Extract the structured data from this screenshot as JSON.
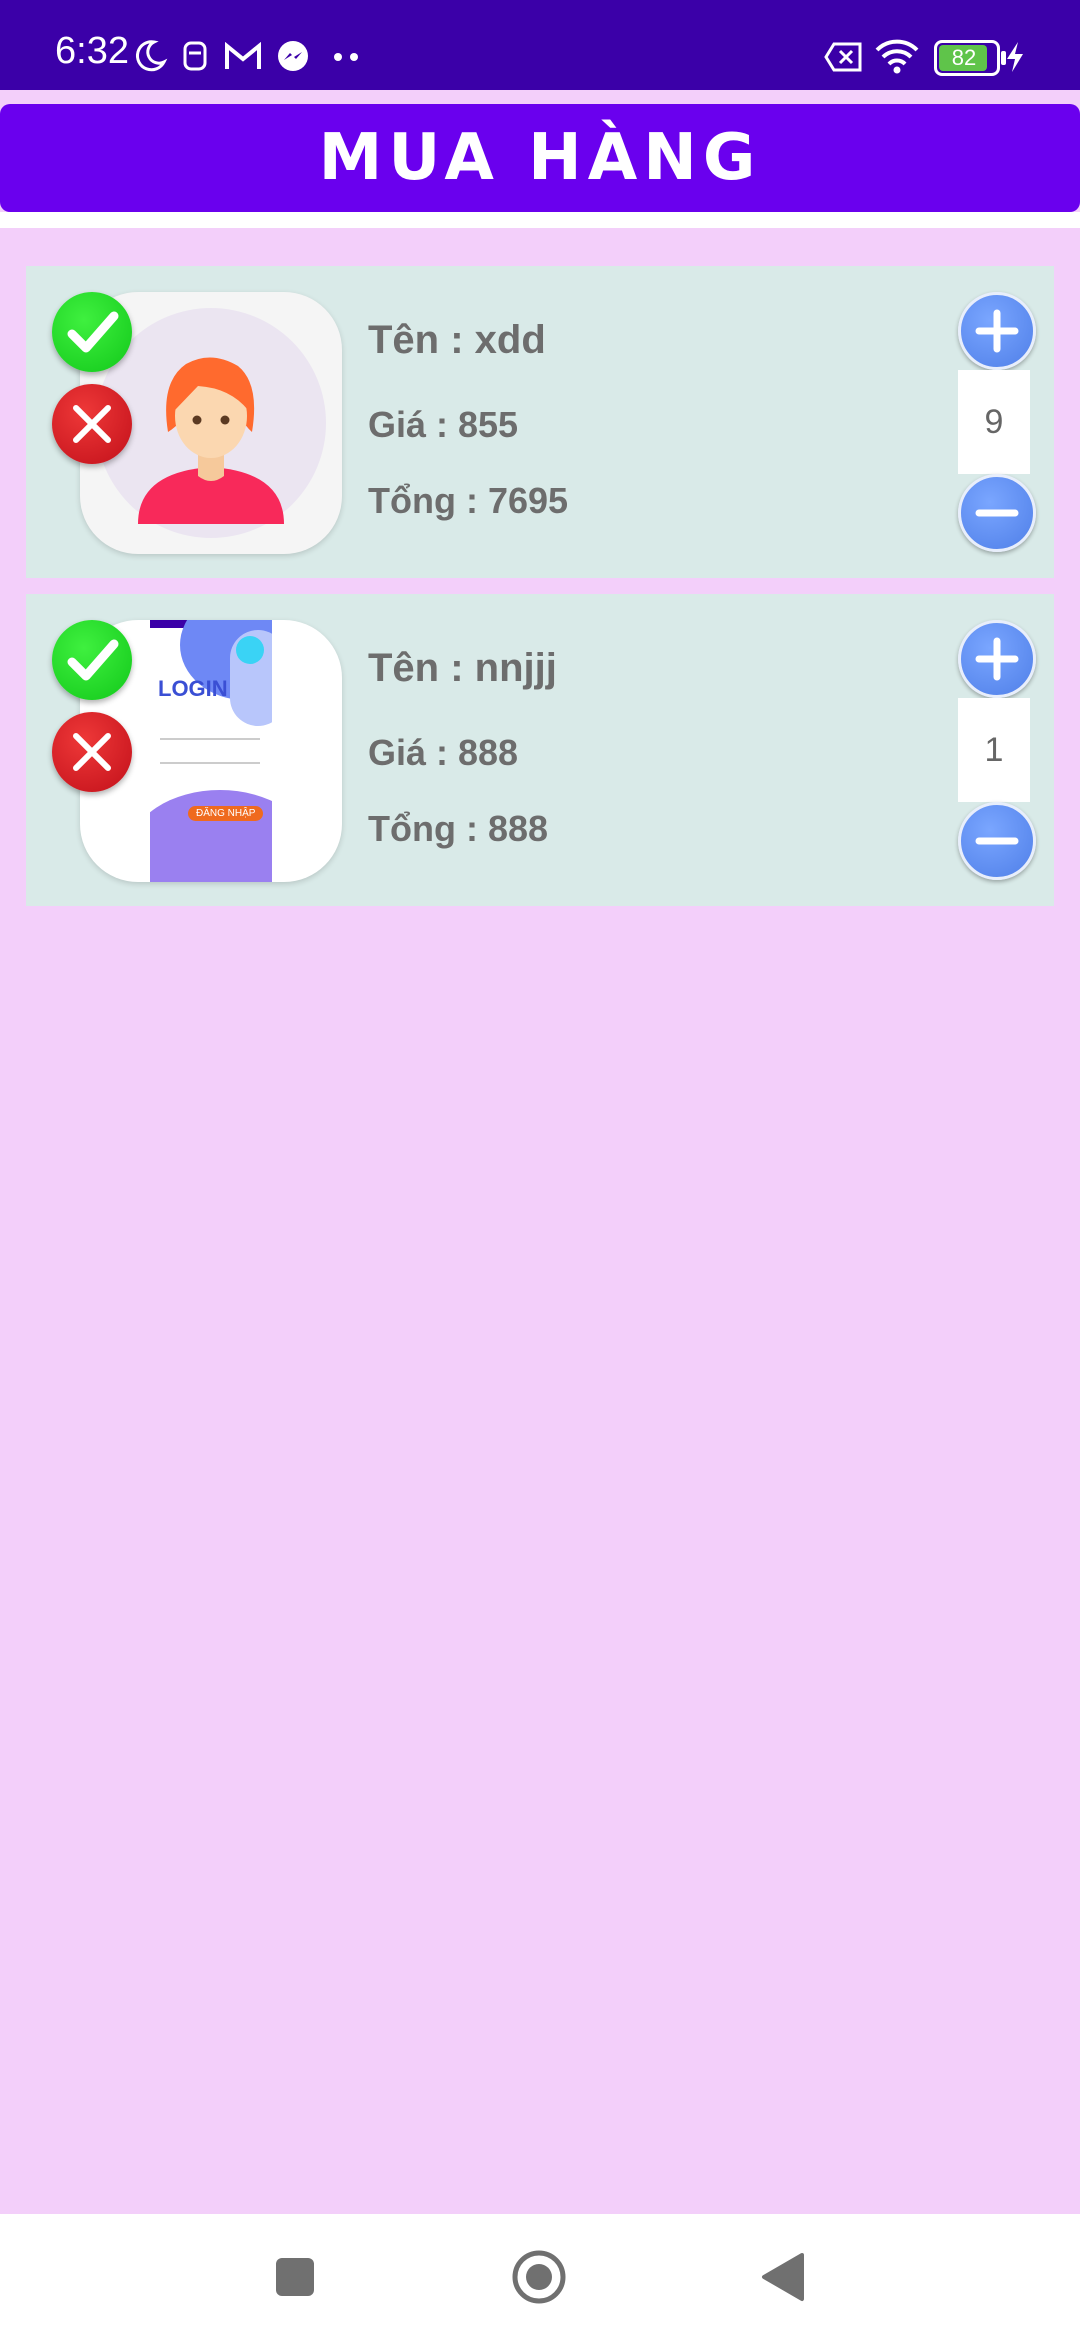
{
  "status_bar": {
    "time": "6:32",
    "battery": "82"
  },
  "header": {
    "title": "MUA HÀNG"
  },
  "thumb_login_text": "LOGIN",
  "thumb_button_text": "ĐĂNG NHẬP",
  "items": [
    {
      "name": "Tên : xdd",
      "price": "Giá : 855",
      "total": "Tổng : 7695",
      "quantity": "9"
    },
    {
      "name": "Tên : nnjjj",
      "price": "Giá : 888",
      "total": "Tổng : 888",
      "quantity": "1"
    }
  ],
  "colors": {
    "primary": "#6a00ee",
    "status_bar": "#3b00a8",
    "background": "#f3cffa",
    "card": "#d9eae8"
  }
}
